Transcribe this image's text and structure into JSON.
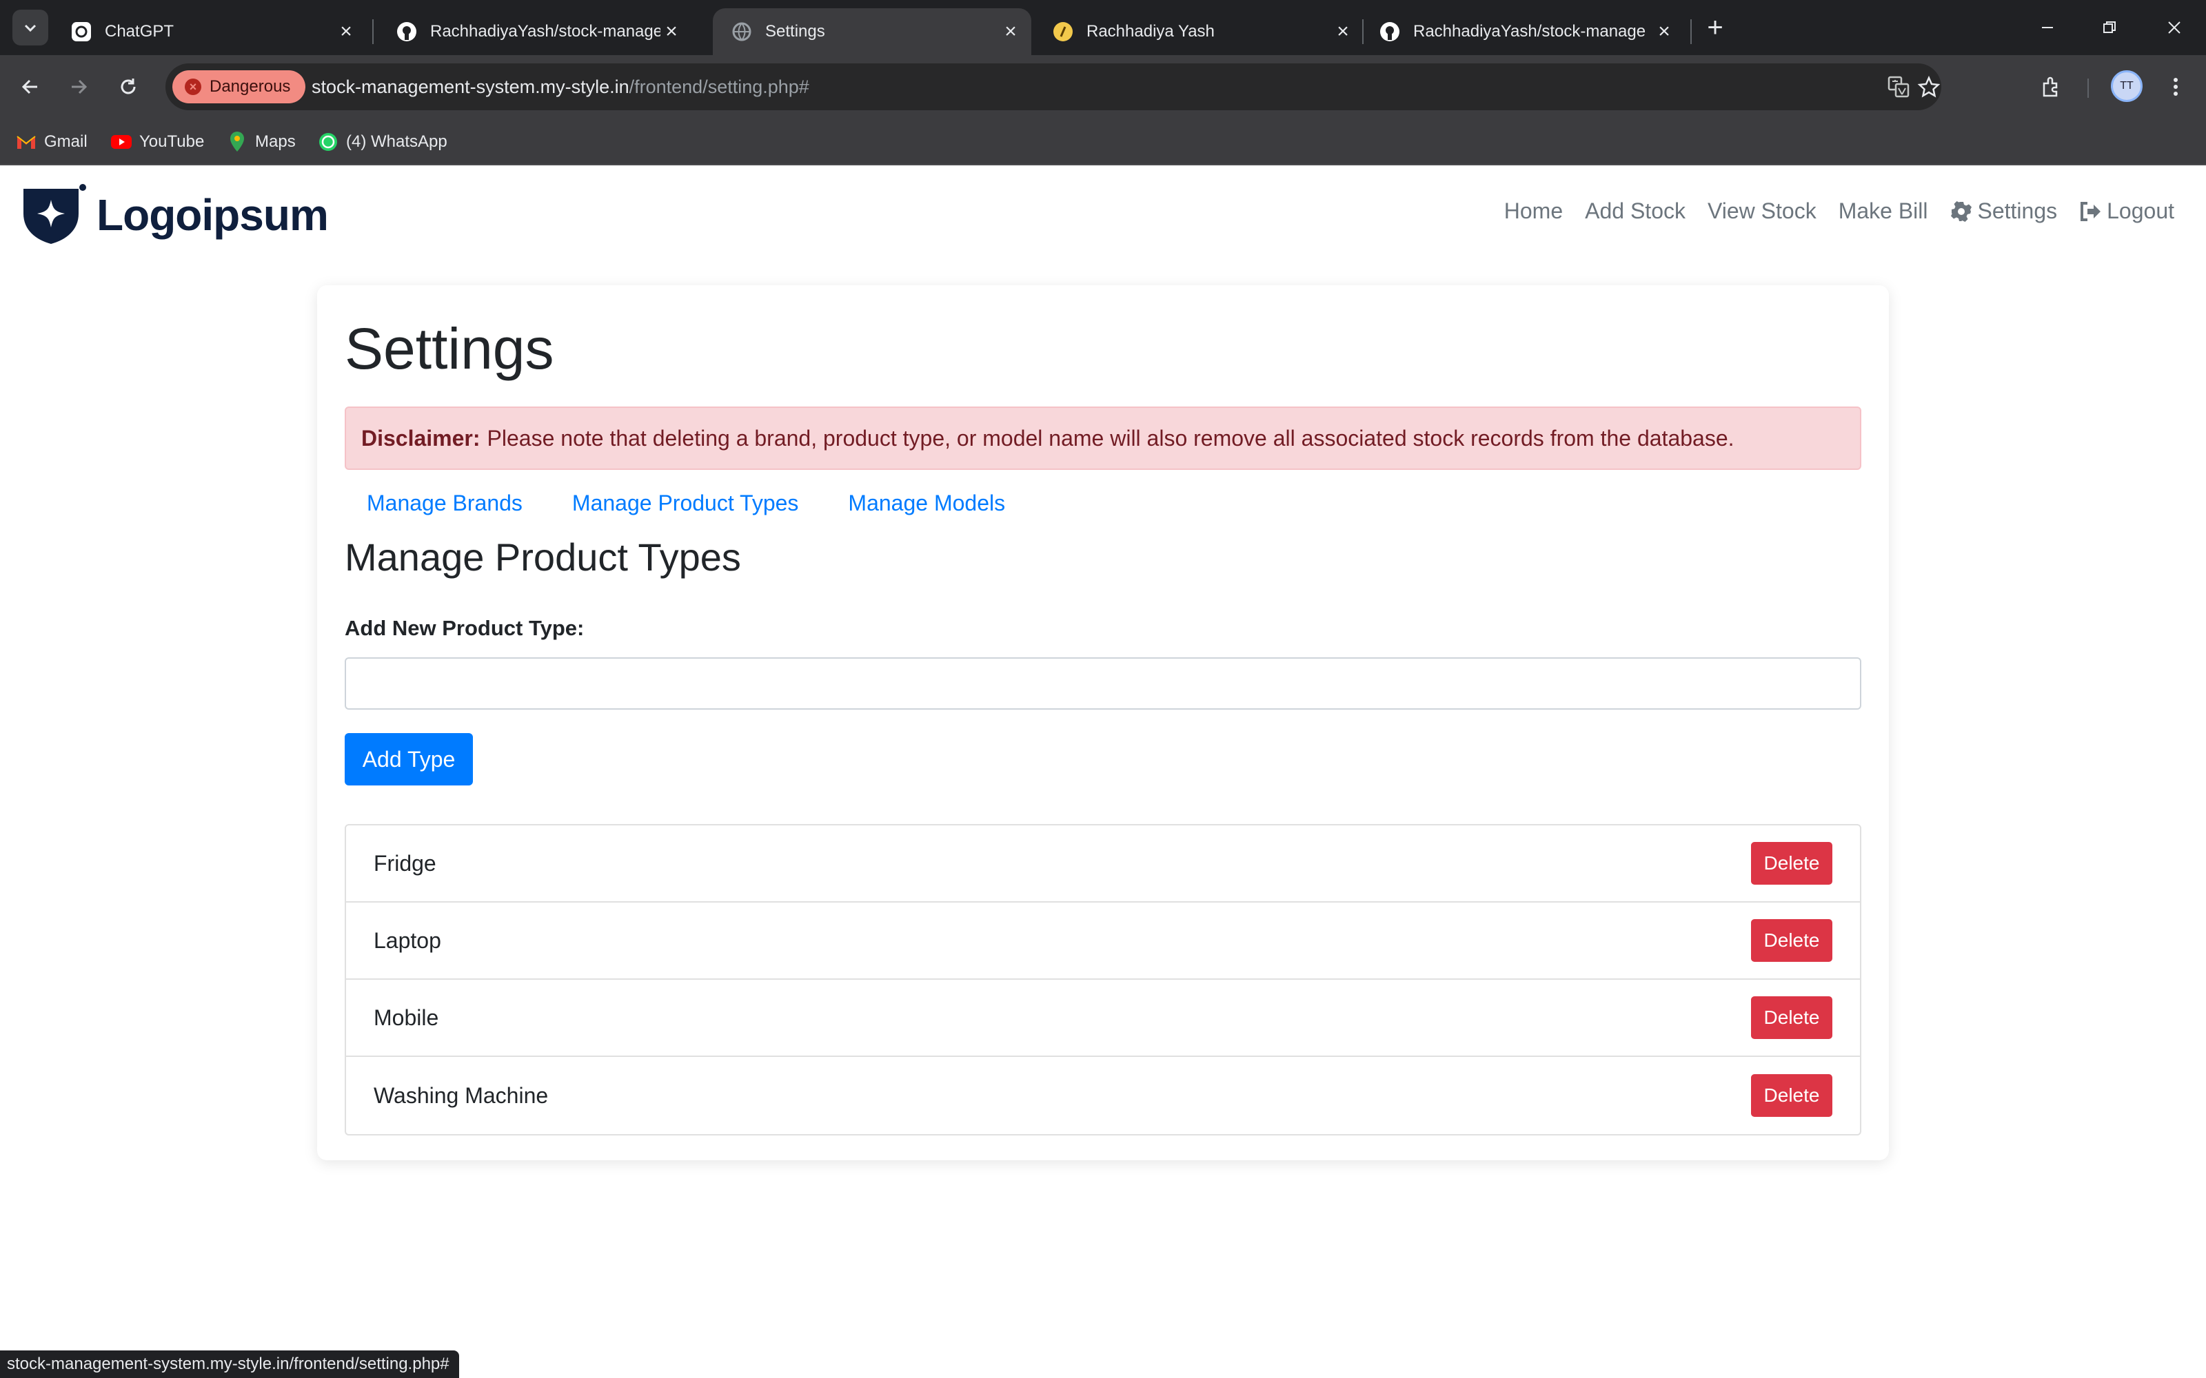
{
  "browser": {
    "tabs": [
      {
        "title": "ChatGPT",
        "icon": "chatgpt-icon",
        "active": false
      },
      {
        "title": "RachhadiyaYash/stock-manage",
        "icon": "github-icon",
        "active": false
      },
      {
        "title": "Settings",
        "icon": "globe-icon",
        "active": true
      },
      {
        "title": "Rachhadiya Yash",
        "icon": "portfolio-icon",
        "active": false
      },
      {
        "title": "RachhadiyaYash/stock-manage",
        "icon": "github-icon",
        "active": false
      }
    ],
    "security_chip": "Dangerous",
    "url_host": "stock-management-system.my-style.in",
    "url_path": "/frontend/setting.php#",
    "bookmarks": [
      {
        "label": "Gmail",
        "icon": "gmail-icon"
      },
      {
        "label": "YouTube",
        "icon": "youtube-icon"
      },
      {
        "label": "Maps",
        "icon": "maps-icon"
      },
      {
        "label": "(4) WhatsApp",
        "icon": "whatsapp-icon"
      }
    ],
    "status_url": "stock-management-system.my-style.in/frontend/setting.php#"
  },
  "site": {
    "logo_text": "Logoipsum",
    "nav": {
      "home": "Home",
      "add_stock": "Add Stock",
      "view_stock": "View Stock",
      "make_bill": "Make Bill",
      "settings": "Settings",
      "logout": "Logout"
    }
  },
  "settings": {
    "title": "Settings",
    "disclaimer_label": "Disclaimer:",
    "disclaimer_text": "Please note that deleting a brand, product type, or model name will also remove all associated stock records from the database.",
    "tabs": {
      "brands": "Manage Brands",
      "product_types": "Manage Product Types",
      "models": "Manage Models"
    },
    "section_title": "Manage Product Types",
    "field_label": "Add New Product Type:",
    "input_value": "",
    "add_button": "Add Type",
    "delete_label": "Delete",
    "items": [
      "Fridge",
      "Laptop",
      "Mobile",
      "Washing Machine"
    ]
  },
  "colors": {
    "primary": "#007bff",
    "danger": "#dc3545",
    "alert_bg": "#f8d7da",
    "alert_text": "#721c24",
    "logo": "#0f1f3d"
  }
}
